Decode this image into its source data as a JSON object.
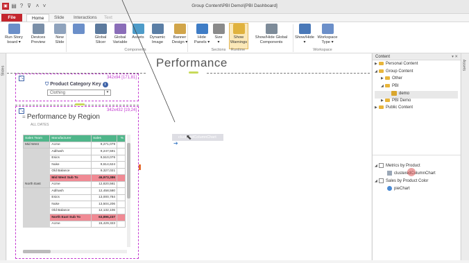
{
  "app": {
    "title": "Group Content\\PBI Demo\\[PBI Dashboard]"
  },
  "tabs": [
    "File",
    "Home",
    "Slide",
    "Interactions",
    "Text"
  ],
  "ribbon": {
    "buttons": [
      {
        "label": "Run Story\nboard ▾",
        "color": "#6b8fc9"
      },
      {
        "label": "Devices\nPreview",
        "color": "#7a8fa8"
      },
      {
        "label": "New\nSlide",
        "color": "#8fa3bd"
      },
      {
        "label": "",
        "color": "#6b8fc9"
      },
      {
        "label": "Global\nSlicer",
        "color": "#5c7a9e"
      },
      {
        "label": "Global\nVariable",
        "color": "#8a6db8"
      },
      {
        "label": "Assets",
        "color": "#4e9cc9"
      },
      {
        "label": "Dynamic\nImage",
        "color": "#5b7fa6"
      },
      {
        "label": "Banner\nDesign ▾",
        "color": "#d1a54a"
      },
      {
        "label": "Hide\nPanels ▾",
        "color": "#3f7dc6"
      },
      {
        "label": "Size\n▾",
        "color": "#8a8a8a"
      },
      {
        "label": "Show\nWarnings",
        "color": "#e0b23d"
      },
      {
        "label": "Show/Hide Global\nComponents",
        "color": "#7d8b99"
      },
      {
        "label": "Show/Hide\n▾",
        "color": "#4a79b8"
      },
      {
        "label": "Workspace\nType ▾",
        "color": "#6b8fc9"
      }
    ],
    "groups": [
      "Components",
      "Sections",
      "Runtime",
      "Workspace"
    ]
  },
  "left_rail": "Slides",
  "canvas": {
    "title": "Performance",
    "filter_widget": {
      "tag": "342x94 [171,81]",
      "label": "Product Category Key",
      "value": "Clothing"
    },
    "perf_widget": {
      "tag": "342x432 [19,24]",
      "title": "Performance by Region",
      "subtitle": "ALL DATES",
      "headers": [
        "Sales Team",
        "Manufacturer",
        "Sales",
        "%"
      ],
      "rows": [
        {
          "team": "Mid West",
          "mfr": "Acme",
          "sales": "9,271,079",
          "hl": false
        },
        {
          "team": "",
          "mfr": "Adihash",
          "sales": "9,247,591",
          "hl": false
        },
        {
          "team": "",
          "mfr": "Esics",
          "sales": "9,510,076",
          "hl": false
        },
        {
          "team": "",
          "mfr": "Nuke",
          "sales": "9,614,624",
          "hl": false
        },
        {
          "team": "",
          "mfr": "Old Balance",
          "sales": "9,327,021",
          "hl": false
        },
        {
          "team": "",
          "mfr": "Mid West Sub To",
          "sales": "46,973,386",
          "hl": true
        },
        {
          "team": "North East",
          "mfr": "Acme",
          "sales": "12,820,561",
          "hl": false
        },
        {
          "team": "",
          "mfr": "Adihash",
          "sales": "12,458,580",
          "hl": false
        },
        {
          "team": "",
          "mfr": "Esics",
          "sales": "13,000,784",
          "hl": false
        },
        {
          "team": "",
          "mfr": "Nuke",
          "sales": "13,504,206",
          "hl": false
        },
        {
          "team": "",
          "mfr": "Old Balance",
          "sales": "12,132,106",
          "hl": false
        },
        {
          "team": "",
          "mfr": "North East Sub To",
          "sales": "63,896,237",
          "hl": true
        },
        {
          "team": "",
          "mfr": "Acme",
          "sales": "15,429,323",
          "hl": false
        }
      ]
    },
    "drag_ghost": "clusteredColumnChart"
  },
  "content_panel": {
    "header": "Content",
    "header_ctrl": "▾ ✕",
    "tree": [
      {
        "label": "Personal Content",
        "indent": 0,
        "arrow": "▶",
        "icon": "folder"
      },
      {
        "label": "Group Content",
        "indent": 0,
        "arrow": "◢",
        "icon": "folder"
      },
      {
        "label": "Other",
        "indent": 1,
        "arrow": "▶",
        "icon": "folder"
      },
      {
        "label": "PBI",
        "indent": 1,
        "arrow": "◢",
        "icon": "folder"
      },
      {
        "label": "demo",
        "indent": 2,
        "arrow": "",
        "icon": "item"
      },
      {
        "label": "PBI Demo",
        "indent": 1,
        "arrow": "▶",
        "icon": "folder"
      },
      {
        "label": "Public Content",
        "indent": 0,
        "arrow": "▶",
        "icon": "folder"
      }
    ],
    "tree2": [
      {
        "label": "Metrics by Product",
        "indent": 0,
        "arrow": "◢"
      },
      {
        "label": "clusteredColumnChart",
        "indent": 1,
        "arrow": ""
      },
      {
        "label": "Sales by Product Color",
        "indent": 0,
        "arrow": "◢"
      },
      {
        "label": "pieChart",
        "indent": 1,
        "arrow": ""
      }
    ]
  },
  "assets_rail": "Assets"
}
